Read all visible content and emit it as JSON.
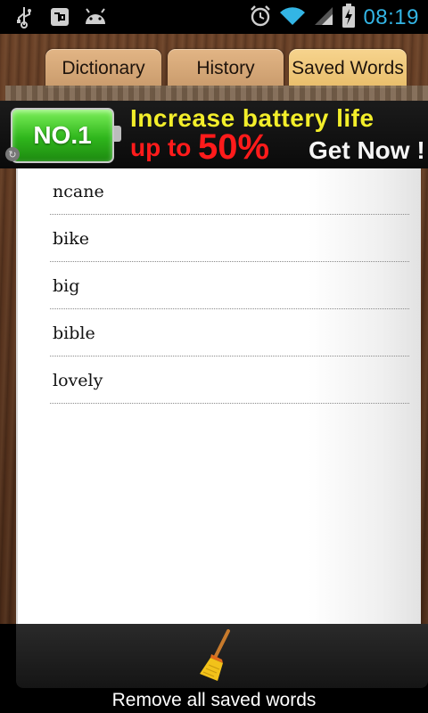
{
  "status_bar": {
    "time": "08:19",
    "left_icons": [
      "usb-icon",
      "voicemail-icon",
      "android-icon"
    ],
    "right_icons": [
      "alarm-icon",
      "wifi-icon",
      "signal-icon",
      "battery-charging-icon"
    ]
  },
  "tabs": [
    {
      "label": "Dictionary",
      "active": false
    },
    {
      "label": "History",
      "active": false
    },
    {
      "label": "Saved Words",
      "active": true
    }
  ],
  "ad": {
    "badge": "NO.1",
    "line1": "Increase battery life",
    "line2_prefix": "up to",
    "line2_value": "50%",
    "cta": "Get Now !"
  },
  "saved_words": [
    {
      "word": "ncane"
    },
    {
      "word": "bike"
    },
    {
      "word": "big"
    },
    {
      "word": "bible"
    },
    {
      "word": "lovely"
    }
  ],
  "bottom": {
    "action_label": "Remove all saved words",
    "action_icon": "broom-icon"
  }
}
